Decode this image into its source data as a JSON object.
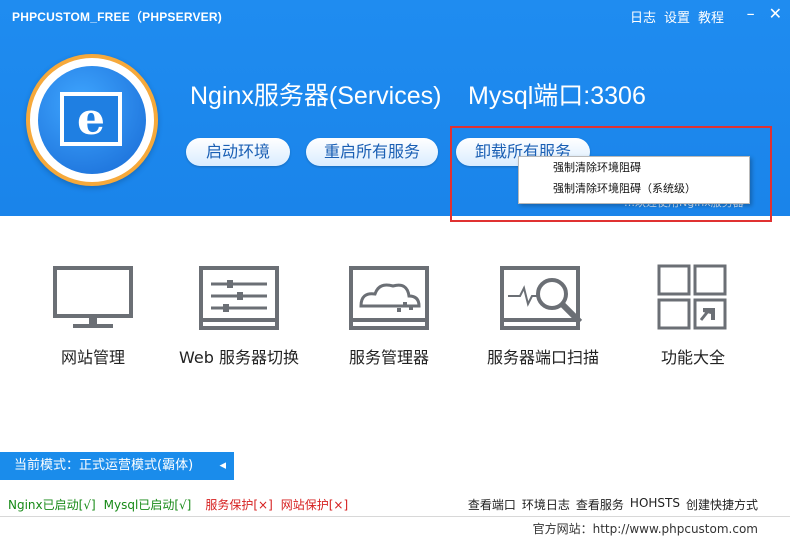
{
  "window": {
    "title": "PHPCUSTOM_FREE（PHPSERVER)",
    "menu": [
      "日志",
      "设置",
      "教程"
    ],
    "minimize": "–",
    "close": "✕"
  },
  "header": {
    "server_title": "Nginx服务器(Services)",
    "mysql_port": "Mysql端口:3306",
    "buttons": {
      "start": "启动环境",
      "restart": "重启所有服务",
      "uninstall": "卸载所有服务"
    },
    "hint": "…欢迎使用Nginx服务器",
    "dropdown": [
      "强制清除环境阻碍",
      "强制清除环境阻碍（系统级）"
    ]
  },
  "tools": [
    {
      "label": "网站管理",
      "icon": "monitor-icon"
    },
    {
      "label": "Web 服务器切换",
      "icon": "sliders-icon"
    },
    {
      "label": "服务管理器",
      "icon": "cloud-server-icon"
    },
    {
      "label": "服务器端口扫描",
      "icon": "scan-icon"
    },
    {
      "label": "功能大全",
      "icon": "grid-icon"
    }
  ],
  "mode": {
    "label": "当前模式：正式运营模式(霸体)",
    "arrow": "◂"
  },
  "status": {
    "nginx": "Nginx已启动[√]",
    "mysql": "Mysql已启动[√]",
    "service_protect": "服务保护[×]",
    "site_protect": "网站保护[×]"
  },
  "links": [
    "查看端口",
    "环境日志",
    "查看服务",
    "HOHSTS",
    "创建快捷方式"
  ],
  "footer": {
    "website": "官方网站：http://www.phpcustom.com"
  },
  "colors": {
    "header_blue": "#1f8cf0",
    "logo_ring": "#f6a93b",
    "ok_green": "#178a17",
    "bad_red": "#d62020",
    "highlight_red": "#e03131"
  }
}
